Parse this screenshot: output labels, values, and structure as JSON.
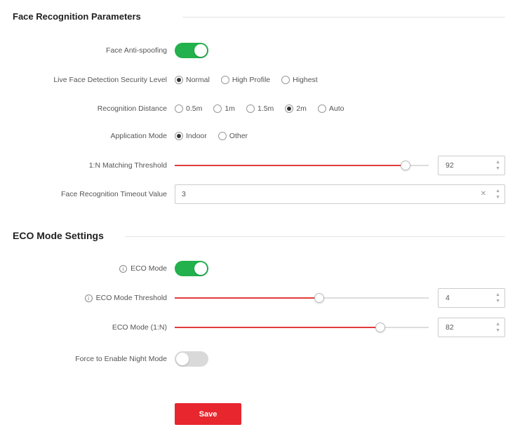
{
  "face_section": {
    "title": "Face Recognition Parameters",
    "anti_spoofing": {
      "label": "Face Anti-spoofing",
      "on": true
    },
    "live_face_level": {
      "label": "Live Face Detection Security Level",
      "options": [
        "Normal",
        "High Profile",
        "Highest"
      ],
      "selected": 0
    },
    "recognition_distance": {
      "label": "Recognition Distance",
      "options": [
        "0.5m",
        "1m",
        "1.5m",
        "2m",
        "Auto"
      ],
      "selected": 3
    },
    "application_mode": {
      "label": "Application Mode",
      "options": [
        "Indoor",
        "Other"
      ],
      "selected": 0
    },
    "matching_threshold": {
      "label": "1:N Matching Threshold",
      "value": "92",
      "fraction": 0.91
    },
    "interval_value": {
      "label": "Face Recognition Timeout Value",
      "value": "3",
      "clear_icon": "clear-x-icon"
    }
  },
  "eco_section": {
    "title": "ECO Mode Settings",
    "eco_mode": {
      "label": "ECO Mode",
      "on": true,
      "info_icon": "info-icon"
    },
    "eco_threshold": {
      "label": "ECO Mode Threshold",
      "value": "4",
      "fraction": 0.57,
      "info_icon": "info-icon"
    },
    "eco_1n": {
      "label": "ECO Mode (1:N)",
      "value": "82",
      "fraction": 0.81
    },
    "night_mode": {
      "label": "Force to Enable Night Mode",
      "on": false
    }
  },
  "actions": {
    "save_label": "Save"
  },
  "colors": {
    "accent_green": "#22b14c",
    "accent_red": "#e23b3b",
    "button_red": "#e8262d"
  }
}
